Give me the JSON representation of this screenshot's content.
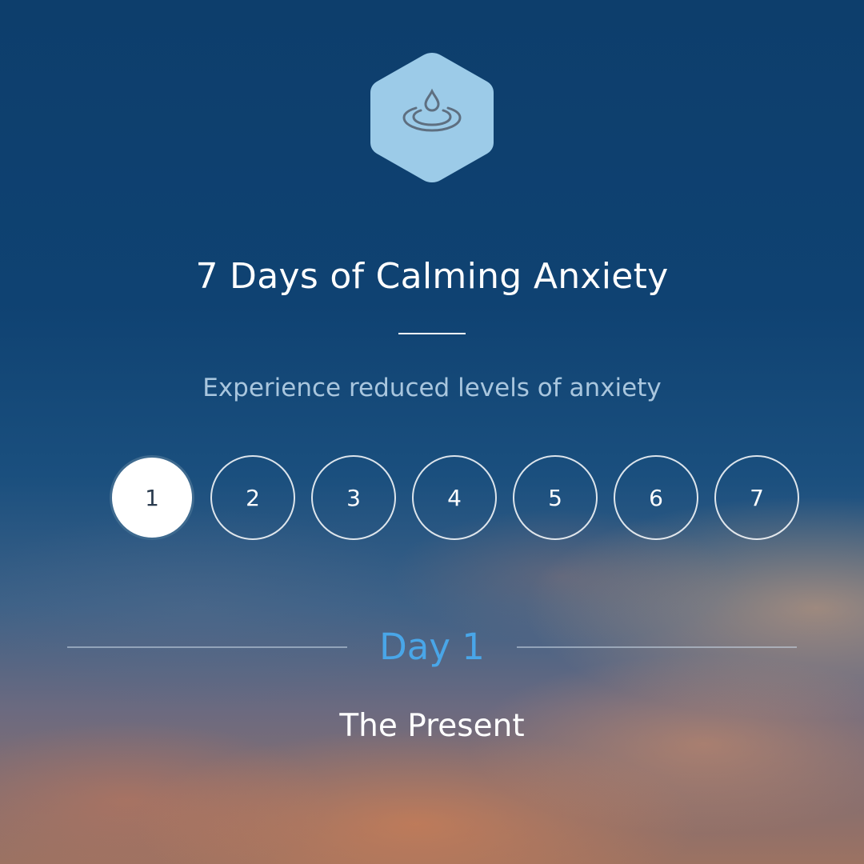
{
  "header": {
    "icon": "water-drop-ripple-icon",
    "title": "7 Days of Calming Anxiety",
    "subtitle": "Experience reduced levels of anxiety"
  },
  "days": [
    {
      "label": "1",
      "active": true
    },
    {
      "label": "2",
      "active": false
    },
    {
      "label": "3",
      "active": false
    },
    {
      "label": "4",
      "active": false
    },
    {
      "label": "5",
      "active": false
    },
    {
      "label": "6",
      "active": false
    },
    {
      "label": "7",
      "active": false
    }
  ],
  "selected_day": {
    "label": "Day 1",
    "session_title": "The Present"
  },
  "colors": {
    "accent": "#49a6e8",
    "hex_badge": "#9ccbe8",
    "icon_stroke": "#5e6f80",
    "sky_top": "#0d3e6c",
    "sunset": "#dc8250"
  }
}
